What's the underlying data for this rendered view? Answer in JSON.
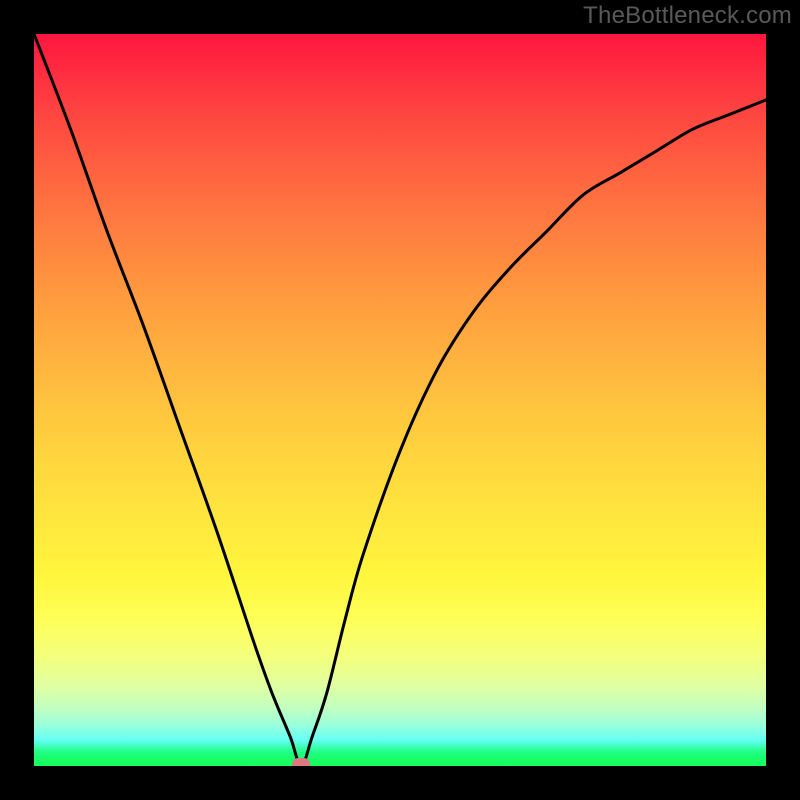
{
  "watermark": "TheBottleneck.com",
  "chart_data": {
    "type": "line",
    "title": "",
    "xlabel": "",
    "ylabel": "",
    "xlim": [
      0,
      1
    ],
    "ylim": [
      0,
      1
    ],
    "legend": false,
    "grid": false,
    "minimum_point": {
      "x": 0.365,
      "y": 0.0
    },
    "minimum_marker_color": "#d87a7e",
    "background_gradient_top": "#fe163f",
    "background_gradient_bottom": "#15fe5c",
    "curve_color": "#000000",
    "series": [
      {
        "name": "bottleneck-curve",
        "x": [
          0.0,
          0.05,
          0.1,
          0.15,
          0.2,
          0.25,
          0.3,
          0.325,
          0.35,
          0.365,
          0.38,
          0.4,
          0.425,
          0.45,
          0.5,
          0.55,
          0.6,
          0.65,
          0.7,
          0.75,
          0.8,
          0.85,
          0.9,
          0.95,
          1.0
        ],
        "y": [
          1.0,
          0.87,
          0.73,
          0.6,
          0.46,
          0.32,
          0.17,
          0.1,
          0.04,
          0.0,
          0.04,
          0.1,
          0.2,
          0.29,
          0.43,
          0.54,
          0.62,
          0.68,
          0.73,
          0.78,
          0.81,
          0.84,
          0.87,
          0.89,
          0.91
        ]
      }
    ]
  }
}
